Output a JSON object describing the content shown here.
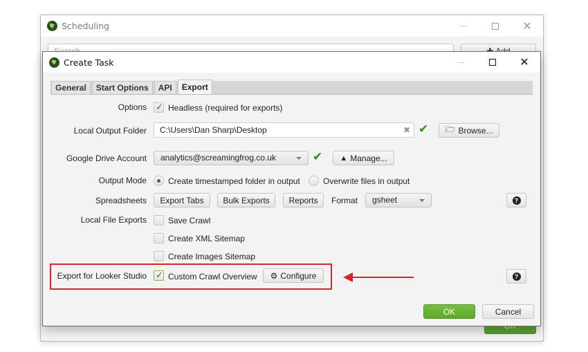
{
  "back_window": {
    "title": "Scheduling",
    "search_placeholder": "Search",
    "add_label": "Add",
    "ok_label": "OK"
  },
  "dialog": {
    "title": "Create Task",
    "tabs": [
      {
        "label": "General",
        "active": false
      },
      {
        "label": "Start Options",
        "active": false
      },
      {
        "label": "API",
        "active": false
      },
      {
        "label": "Export",
        "active": true
      }
    ],
    "options": {
      "label": "Options",
      "headless_label": "Headless (required for exports)",
      "headless_checked": true
    },
    "local_output_folder": {
      "label": "Local Output Folder",
      "value": "C:\\Users\\Dan Sharp\\Desktop",
      "browse_label": "Browse..."
    },
    "google_drive": {
      "label": "Google Drive Account",
      "value": "analytics@screamingfrog.co.uk",
      "manage_label": "Manage..."
    },
    "output_mode": {
      "label": "Output Mode",
      "options": [
        {
          "label": "Create timestamped folder in output",
          "selected": true
        },
        {
          "label": "Overwrite files in output",
          "selected": false
        }
      ]
    },
    "spreadsheets": {
      "label": "Spreadsheets",
      "buttons": [
        "Export Tabs",
        "Bulk Exports",
        "Reports"
      ],
      "format_label": "Format",
      "format_value": "gsheet"
    },
    "local_file_exports": {
      "label": "Local File Exports",
      "items": [
        {
          "label": "Save Crawl",
          "checked": false
        },
        {
          "label": "Create XML Sitemap",
          "checked": false
        },
        {
          "label": "Create Images Sitemap",
          "checked": false
        }
      ]
    },
    "looker_studio": {
      "label": "Export for Looker Studio",
      "checkbox_label": "Custom Crawl Overview",
      "checked": true,
      "configure_label": "Configure"
    },
    "ok_label": "OK",
    "cancel_label": "Cancel"
  },
  "annotation": {
    "highlight_color": "#d9232d"
  }
}
